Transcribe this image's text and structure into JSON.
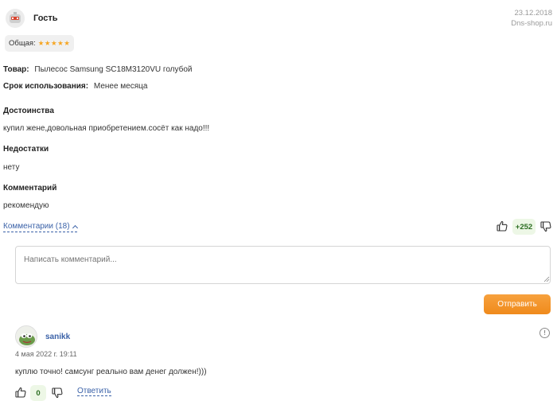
{
  "review": {
    "author": "Гость",
    "date": "23.12.2018",
    "source": "Dns-shop.ru",
    "rating_label": "Общая:",
    "rating_stars": "★★★★★",
    "rating_value": 5,
    "product_label": "Товар:",
    "product_value": "Пылесос Samsung SC18M3120VU голубой",
    "usage_label": "Срок использования:",
    "usage_value": "Менее месяца",
    "pros_title": "Достоинства",
    "pros_text": "купил жене,довольная приобретением.сосёт как надо!!!",
    "cons_title": "Недостатки",
    "cons_text": "нету",
    "comment_title": "Комментарий",
    "comment_text": "рекомендую",
    "comments_toggle": "Комментарии (18)",
    "score": "+252"
  },
  "new_comment": {
    "placeholder": "Написать комментарий...",
    "submit_label": "Отправить"
  },
  "comments": [
    {
      "author": "sanikk",
      "date": "4 мая 2022 г. 19:11",
      "text": "куплю точно! самсунг реально вам денег должен!)))",
      "score": "0",
      "reply_label": "Ответить",
      "info_glyph": "!"
    }
  ],
  "colors": {
    "accent_link": "#3b62a8",
    "button": "#ef8a1c",
    "star": "#f6a623",
    "score_bg": "#edf7e6",
    "score_text": "#2c6e22"
  },
  "icons": {
    "vote_up": "thumbs-up-icon",
    "vote_down": "thumbs-down-icon",
    "info": "info-icon"
  }
}
